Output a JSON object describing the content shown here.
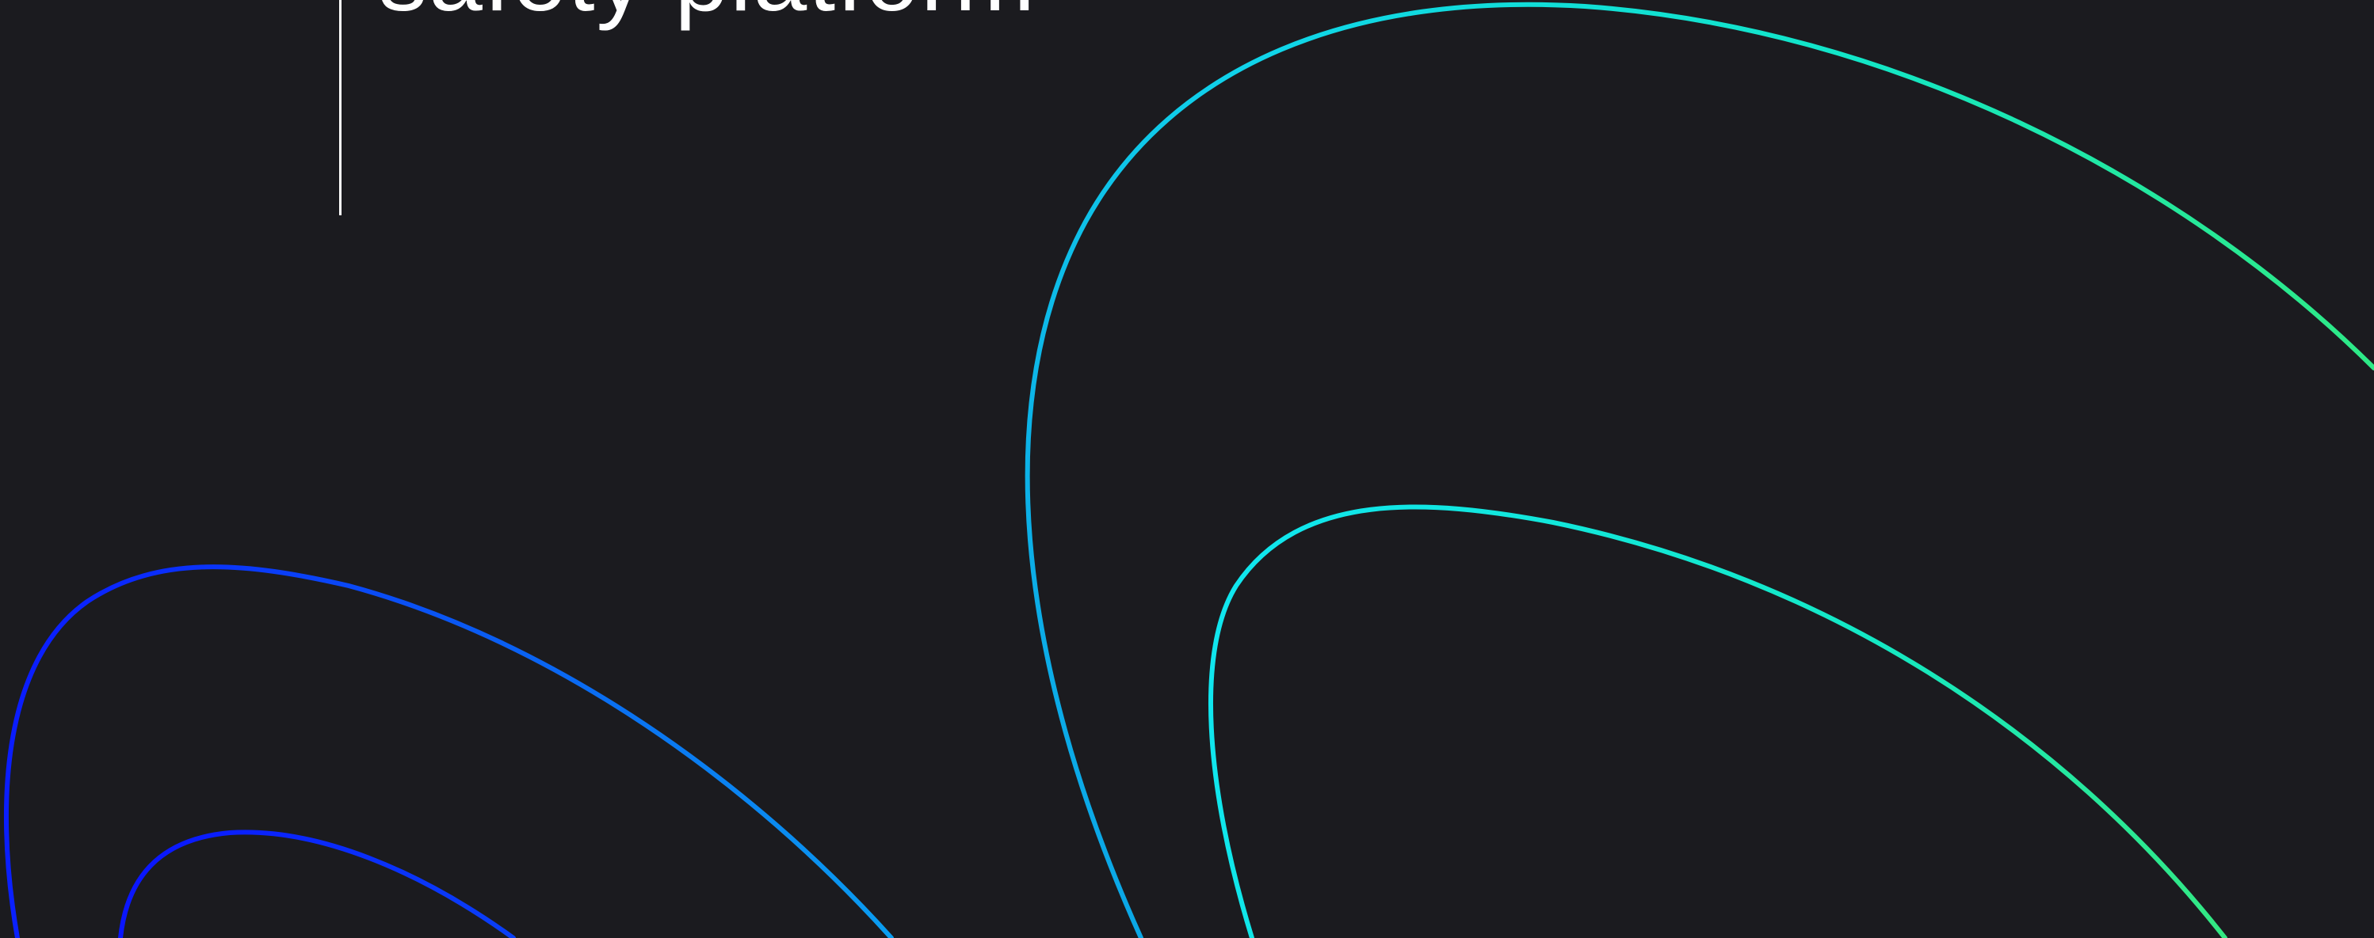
{
  "hero": {
    "headline": "safety platform"
  },
  "colors": {
    "background": "#1b1b1f",
    "text": "#ffffff",
    "gradient_blue": "#0a1cff",
    "gradient_sky": "#0aa0e6",
    "gradient_cyan": "#10e8e8",
    "gradient_green": "#2ee87a"
  }
}
